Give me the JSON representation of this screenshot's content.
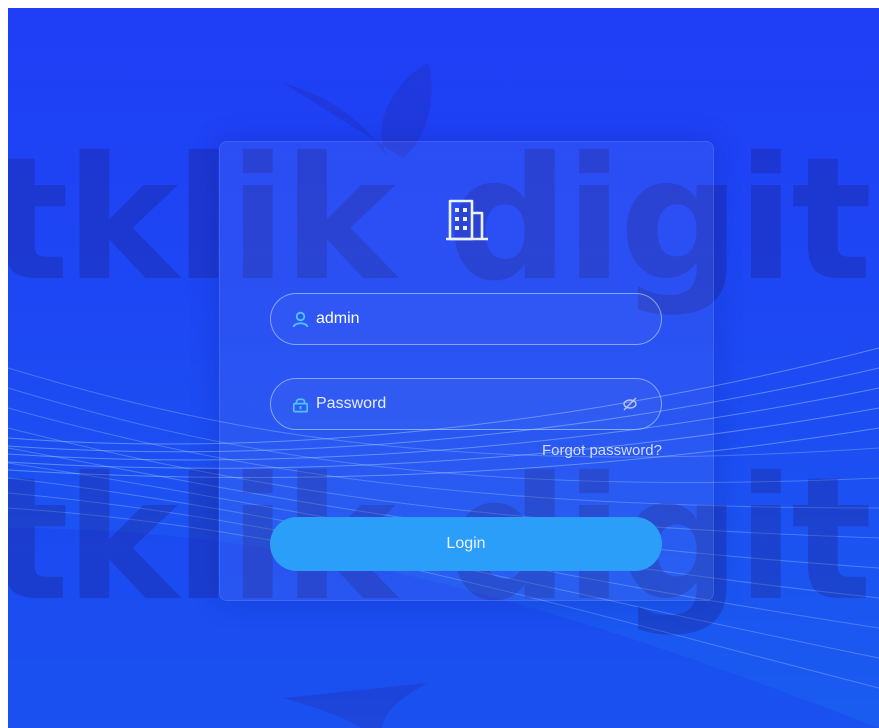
{
  "login": {
    "username_value": "admin",
    "password_placeholder": "Password",
    "forgot_label": "Forgot password?",
    "login_label": "Login"
  },
  "watermark": {
    "text": "tklik digitk"
  },
  "icons": {
    "logo": "building-icon",
    "user": "user-icon",
    "lock": "lock-icon",
    "toggle": "eye-off-icon"
  },
  "colors": {
    "background": "#1f3ef6",
    "button": "#2a9ef8",
    "field_border": "#aac8ff",
    "icon_accent": "#4fc3ff"
  }
}
